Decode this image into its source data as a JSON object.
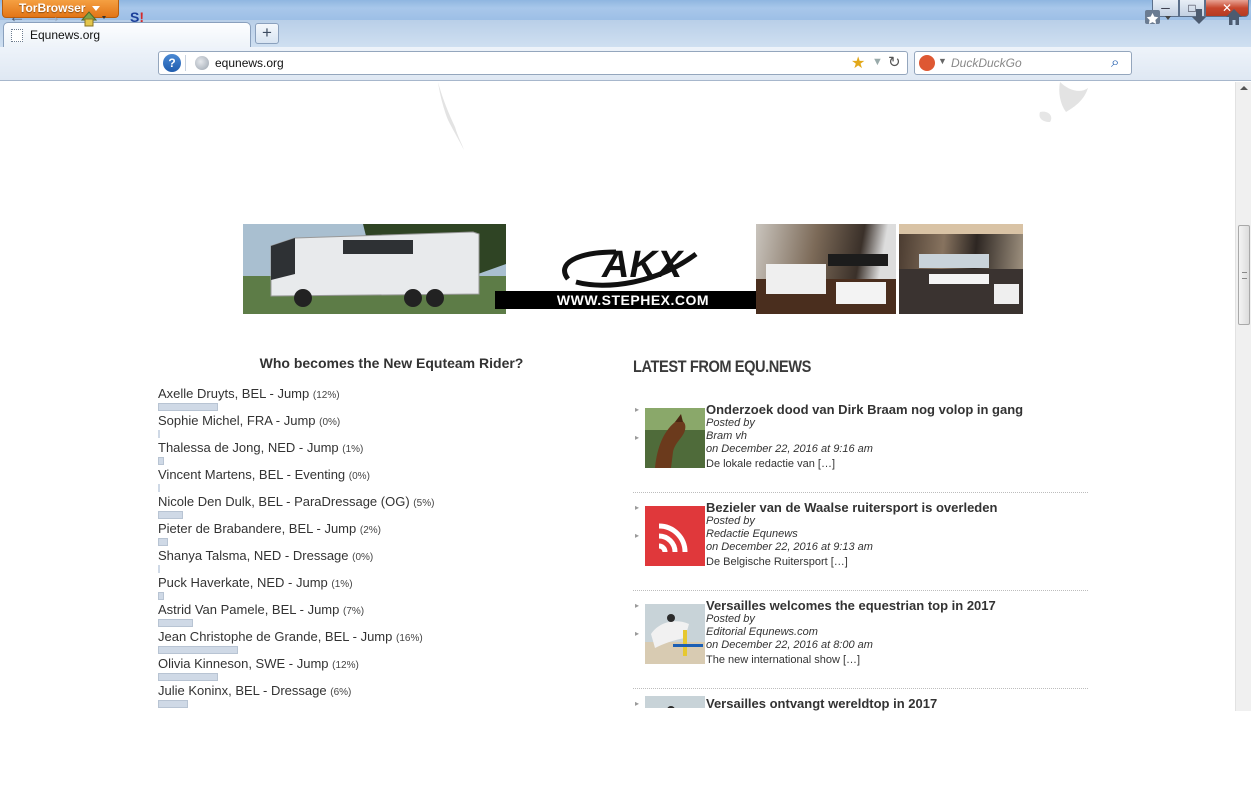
{
  "browser": {
    "app_button": "TorBrowser",
    "tab_title": "Equnews.org",
    "url": "equnews.org",
    "search_placeholder": "DuckDuckGo",
    "window_controls": {
      "minimize": "─",
      "maximize": "□",
      "close": "✕"
    }
  },
  "banner": {
    "logo_url": "WWW.STEPHEX.COM"
  },
  "poll": {
    "title": "Who becomes the New Equteam Rider?",
    "items": [
      {
        "label": "Axelle Druyts, BEL - Jump",
        "pct": "(12%)",
        "value": 12
      },
      {
        "label": "Sophie Michel, FRA - Jump",
        "pct": "(0%)",
        "value": 0
      },
      {
        "label": "Thalessa de Jong, NED - Jump",
        "pct": "(1%)",
        "value": 1
      },
      {
        "label": "Vincent Martens, BEL - Eventing",
        "pct": "(0%)",
        "value": 0
      },
      {
        "label": "Nicole Den Dulk, BEL - ParaDressage (OG)",
        "pct": "(5%)",
        "value": 5
      },
      {
        "label": "Pieter de Brabandere, BEL - Jump",
        "pct": "(2%)",
        "value": 2
      },
      {
        "label": "Shanya Talsma, NED - Dressage",
        "pct": "(0%)",
        "value": 0
      },
      {
        "label": "Puck Haverkate, NED - Jump",
        "pct": "(1%)",
        "value": 1
      },
      {
        "label": "Astrid Van Pamele, BEL - Jump",
        "pct": "(7%)",
        "value": 7
      },
      {
        "label": "Jean Christophe de Grande, BEL - Jump",
        "pct": "(16%)",
        "value": 16
      },
      {
        "label": "Olivia Kinneson, SWE - Jump",
        "pct": "(12%)",
        "value": 12
      },
      {
        "label": "Julie Koninx, BEL - Dressage",
        "pct": "(6%)",
        "value": 6
      }
    ]
  },
  "news": {
    "heading": "LATEST FROM EQU.NEWS",
    "items": [
      {
        "title": "Onderzoek dood van Dirk Braam nog volop in gang",
        "posted_by": "Posted by",
        "author": "Bram vh",
        "date": "on December 22, 2016 at 9:16 am",
        "excerpt": "De lokale redactie van […]",
        "thumb": "horse-photo"
      },
      {
        "title": "Bezieler van de Waalse ruitersport is overleden",
        "posted_by": "Posted by",
        "author": "Redactie Equnews",
        "date": "on December 22, 2016 at 9:13 am",
        "excerpt": "De Belgische Ruitersport […]",
        "thumb": "rss-icon"
      },
      {
        "title": "Versailles welcomes the equestrian top in 2017",
        "posted_by": "Posted by",
        "author": "Editorial Equnews.com",
        "date": "on December 22, 2016 at 8:00 am",
        "excerpt": "The new international show […]",
        "thumb": "jumping-photo"
      },
      {
        "title": "Versailles ontvangt wereldtop in 2017",
        "thumb": "jumping-photo"
      }
    ]
  },
  "colors": {
    "rss_red": "#e0383b",
    "poll_bar": "#cfd9e6"
  }
}
